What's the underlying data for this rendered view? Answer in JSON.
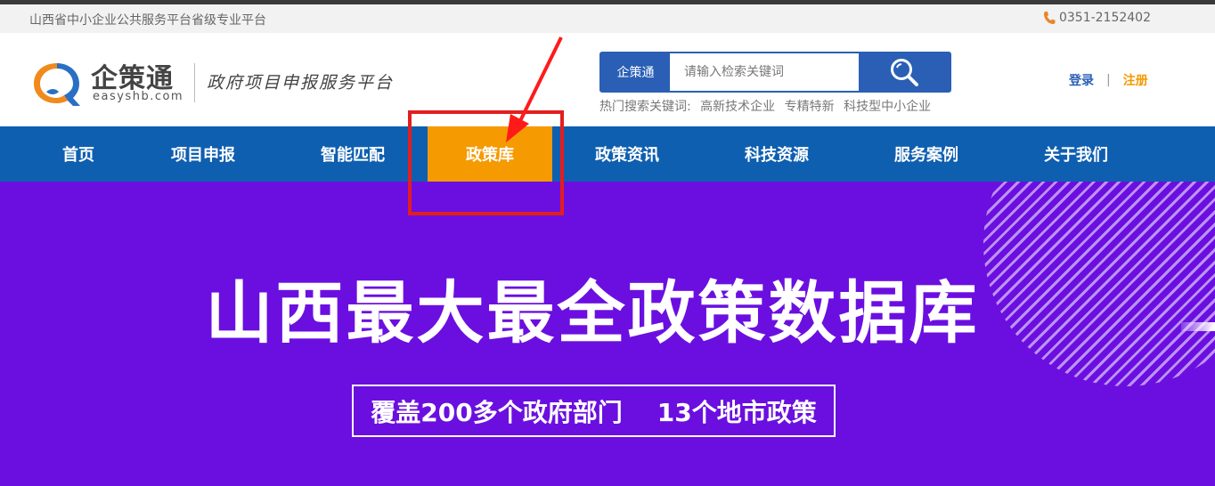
{
  "topbar": {
    "tagline": "山西省中小企业公共服务平台省级专业平台",
    "phone_icon": "phone-icon",
    "phone": "0351-2152402"
  },
  "header": {
    "logo": {
      "brand": "企策通",
      "domain": "easyshb.com",
      "slogan": "政府项目申报服务平台"
    },
    "search": {
      "scope": "企策通",
      "placeholder": "请输入检索关键词",
      "button_icon": "search-icon"
    },
    "hotwords": {
      "label": "热门搜索关键词:",
      "keywords": [
        "高新技术企业",
        "专精特新",
        "科技型中小企业"
      ]
    },
    "auth": {
      "login": "登录",
      "separator": "|",
      "register": "注册"
    }
  },
  "nav": {
    "items": [
      {
        "label": "首页"
      },
      {
        "label": "项目申报"
      },
      {
        "label": "智能匹配"
      },
      {
        "label": "政策库",
        "active": true
      },
      {
        "label": "政策资讯"
      },
      {
        "label": "科技资源"
      },
      {
        "label": "服务案例"
      },
      {
        "label": "关于我们"
      }
    ]
  },
  "banner": {
    "headline": "山西最大最全政策数据库",
    "subtitle": "覆盖200多个政府部门    13个地市政策"
  },
  "colors": {
    "nav_bg": "#0f5fb0",
    "active_tab": "#f59a00",
    "banner_bg": "#6b0fe0",
    "accent_blue": "#2a5fb5",
    "register": "#f39a00",
    "annotation_red": "#e31e1e"
  }
}
